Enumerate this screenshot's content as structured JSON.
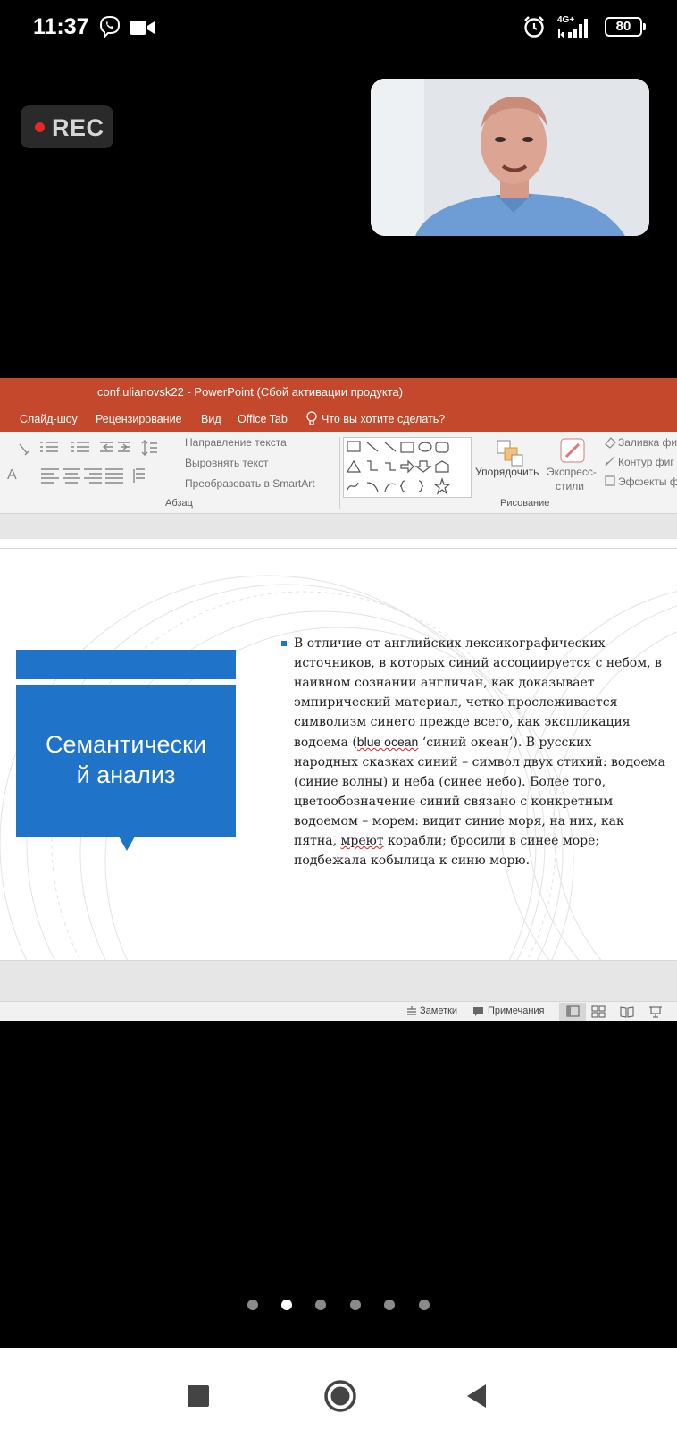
{
  "status_bar": {
    "time": "11:37",
    "network": "4G+",
    "battery": "80",
    "icons": [
      "viber-icon",
      "video-call-icon",
      "alarm-icon",
      "signal-icon",
      "battery-icon"
    ]
  },
  "recording": {
    "label": "REC",
    "dot_color": "#e8262a"
  },
  "camera_tile": {
    "participant_icon": "participant-video"
  },
  "powerpoint": {
    "window_title": "conf.ulianovsk22 - PowerPoint (Сбой активации продукта)",
    "tabs": [
      "Слайд-шоу",
      "Рецензирование",
      "Вид",
      "Office Tab"
    ],
    "tell_me": "Что вы хотите сделать?",
    "ribbon": {
      "text_direction": "Направление текста",
      "align_text": "Выровнять текст",
      "smartart": "Преобразовать в SmartArt",
      "paragraph_group": "Абзац",
      "arrange": "Упорядочить",
      "quick_styles_1": "Экспресс-",
      "quick_styles_2": "стили",
      "shape_fill": "Заливка фи",
      "shape_outline": "Контур фиг",
      "shape_effects": "Эффекты ф",
      "drawing_group": "Рисование"
    },
    "accent_color": "#c3482c",
    "slide": {
      "title_line1": "Семантически",
      "title_line2": "й анализ",
      "title_color": "#1f74c9",
      "body": {
        "l1": "В отличие от английских лексикографических",
        "l2": "источников, в которых синий ассоциируется с небом, в",
        "l3": "наивном сознании англичан, как доказывает",
        "l4": "эмпирический материал, четко прослеживается",
        "l5": "символизм синего прежде всего, как экспликация",
        "l6a": "водоема (",
        "l6b": "blue ocean",
        "l6c": " ‘синий океан’). В русских",
        "l7": "народных сказках синий – символ двух стихий: водоема",
        "l8": "(синие волны) и неба (синее небо). Более того,",
        "l9": "цветообозначение синий связано с конкретным",
        "l10": "водоемом – морем: видит синие моря, на них, как",
        "l11a": "пятна, ",
        "l11b": "мреют",
        "l11c": " корабли; бросили в синее море;",
        "l12": "подбежала кобылица к синю морю."
      }
    },
    "status": {
      "notes": "Заметки",
      "comments": "Примечания"
    }
  },
  "pager": {
    "count": 6,
    "active": 1
  },
  "nav": [
    "recents-button",
    "home-button",
    "back-button"
  ]
}
